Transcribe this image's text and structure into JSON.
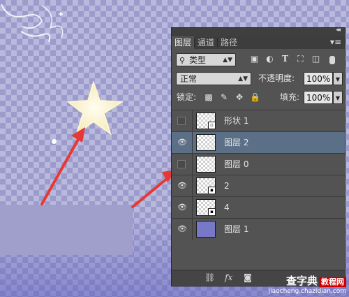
{
  "panel": {
    "tabs": [
      "图层",
      "通道",
      "路径"
    ],
    "active_tab": "图层",
    "filter_kind": "类型",
    "blend_mode": "正常",
    "opacity_label": "不透明度:",
    "opacity_value": "100%",
    "lock_label": "锁定:",
    "fill_label": "填充:",
    "fill_value": "100%",
    "layers": [
      {
        "name": "形状 1",
        "visible": false,
        "selected": false
      },
      {
        "name": "图层 2",
        "visible": true,
        "selected": true
      },
      {
        "name": "图层 0",
        "visible": false,
        "selected": false
      },
      {
        "name": "2",
        "visible": true,
        "selected": false
      },
      {
        "name": "4",
        "visible": true,
        "selected": false
      },
      {
        "name": "图层 1",
        "visible": true,
        "selected": false
      }
    ]
  },
  "watermark": {
    "main": "查字典",
    "box": "教程网",
    "sub": "jiaocheng.chazidian.com"
  },
  "colors": {
    "arrow": "#e53935",
    "selected_layer": "#5b6f87",
    "canvas_rect": "#a09ecb"
  }
}
